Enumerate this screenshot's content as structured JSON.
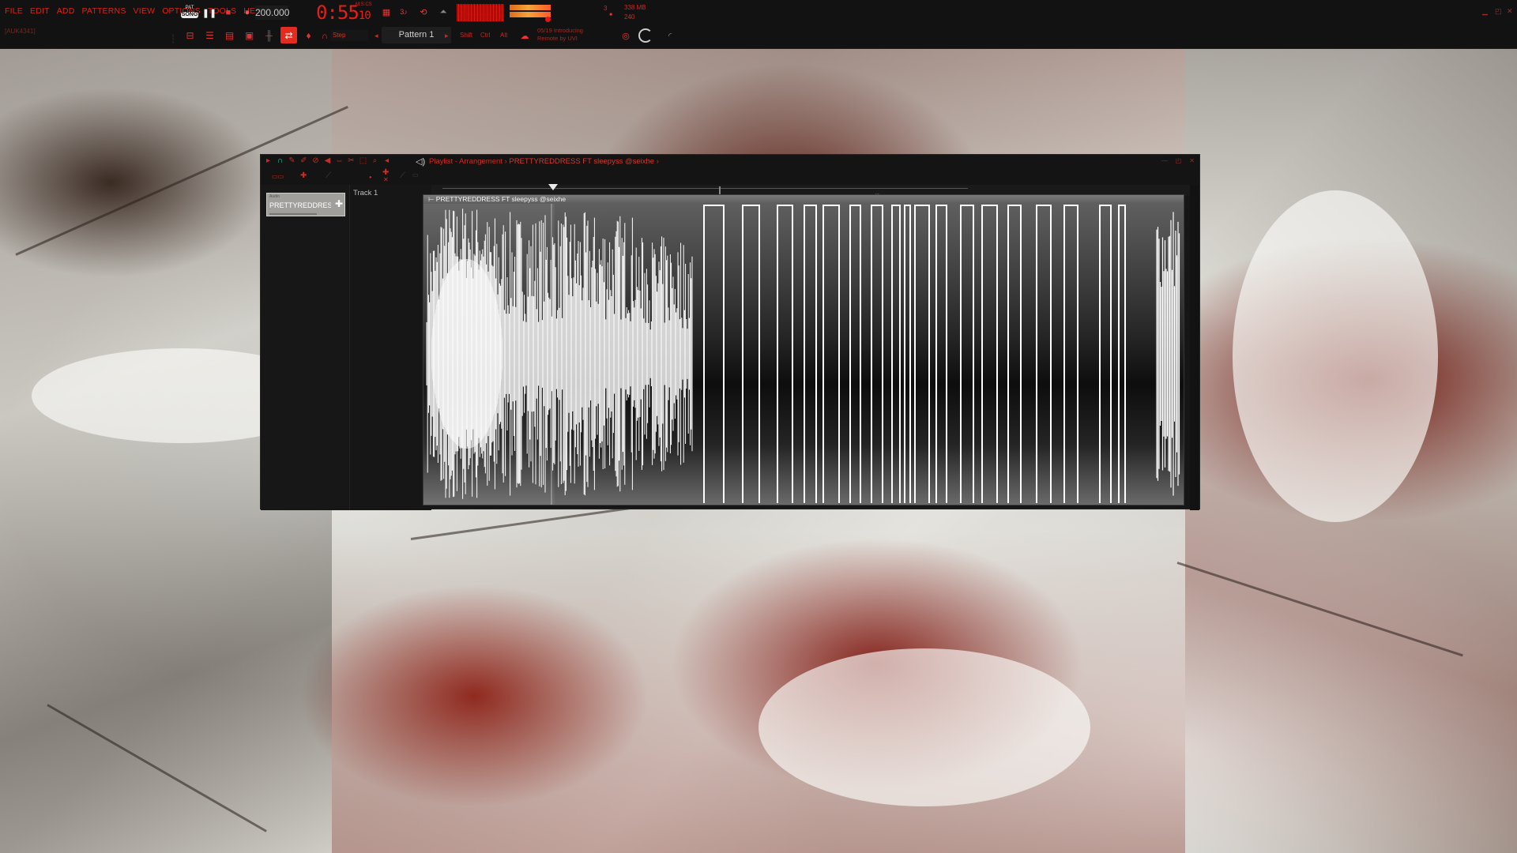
{
  "menu": {
    "items": [
      "FILE",
      "EDIT",
      "ADD",
      "PATTERNS",
      "VIEW",
      "OPTIONS",
      "TOOLS",
      "HELP"
    ]
  },
  "hint_tag": "[AUK4341]",
  "transport": {
    "mode_small": "PAT",
    "mode": "SONG",
    "tempo": "200.000",
    "time_main": "0:55",
    "time_sub": "10",
    "time_label": "M:S:CS",
    "meter_top": "3",
    "cpu_top": "338 MB",
    "cpu_bottom": "240"
  },
  "toolbar": {
    "snap_label": "Step",
    "pattern_name": "Pattern 1",
    "shift_label": "Shift",
    "ctrl_label": "Ctrl",
    "alt_label": "Alt",
    "news_date": "05/19",
    "news_line1": "Introducing",
    "news_line2": "Remote by UVI"
  },
  "playlist": {
    "breadcrumb_prefix": "Playlist - Arrangement",
    "song_name": "PRETTYREDDRESS FT sleepyss @seixhe",
    "ruler_mark": "47",
    "picker_item_small": "Audio",
    "picker_item_label": "PRETTYREDDRESS FT...",
    "track_name": "Track 1",
    "clip_name": "PRETTYREDDRESS FT sleepyss @seixhe"
  },
  "colors": {
    "accent": "#e42b1f",
    "background": "#121212",
    "waveform": "#ffffff"
  },
  "icons": {
    "record": "record-icon",
    "play": "play-pause-icon",
    "stop": "stop-icon",
    "magnet": "snap-magnet-icon",
    "speaker": "speaker-icon"
  }
}
